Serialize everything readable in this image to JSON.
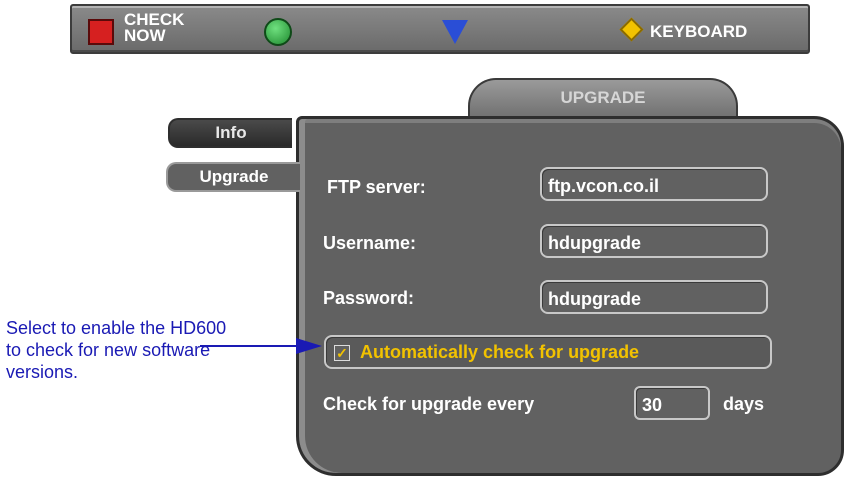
{
  "topbar": {
    "red_key_label": "CHECK\nNOW",
    "yellow_key_label": "KEYBOARD"
  },
  "tabs": {
    "title": "UPGRADE",
    "info": "Info",
    "upgrade": "Upgrade"
  },
  "form": {
    "ftp_label": "FTP server:",
    "ftp_value": "ftp.vcon.co.il",
    "username_label": "Username:",
    "username_value": "hdupgrade",
    "password_label": "Password:",
    "password_value": "hdupgrade",
    "auto_check_label": "Automatically check for upgrade",
    "auto_check_checked": true,
    "interval_prefix": "Check for upgrade every",
    "interval_value": "30",
    "interval_suffix": "days"
  },
  "annotation": {
    "text": "Select to enable the HD600 to check for new software versions."
  },
  "colors": {
    "panel": "#616161",
    "accent_yellow": "#f2c200",
    "annotation_blue": "#1a1ab4"
  }
}
